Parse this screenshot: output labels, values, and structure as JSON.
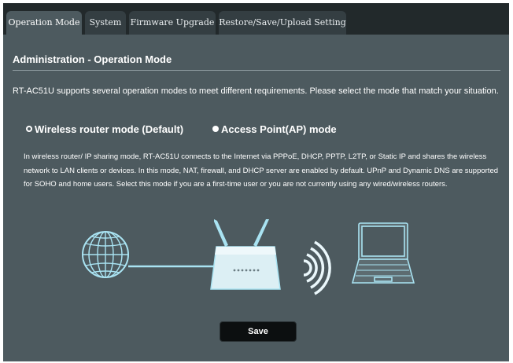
{
  "tabs": [
    {
      "label": "Operation Mode",
      "active": true
    },
    {
      "label": "System",
      "active": false
    },
    {
      "label": "Firmware Upgrade",
      "active": false
    },
    {
      "label": "Restore/Save/Upload Setting",
      "active": false
    }
  ],
  "page": {
    "title": "Administration - Operation Mode",
    "description": "RT-AC51U supports several operation modes to meet different requirements. Please select the mode that match your situation."
  },
  "modes": [
    {
      "label": "Wireless router mode (Default)",
      "selected": true
    },
    {
      "label": "Access Point(AP) mode",
      "selected": false
    }
  ],
  "mode_description": "In wireless router/ IP sharing mode, RT-AC51U connects to the Internet via PPPoE, DHCP, PPTP, L2TP, or Static IP and shares the wireless network to LAN clients or devices. In this mode, NAT, firewall, and DHCP server are enabled by default. UPnP and Dynamic DNS are supported for SOHO and home users. Select this mode if you are a first-time user or you are not currently using any wired/wireless routers.",
  "save_label": "Save",
  "colors": {
    "frame": "#22292b",
    "panel": "#4d5a5f",
    "tab": "#343e42",
    "illustration": "#a9e3f2"
  },
  "diagram_icons": [
    "globe-icon",
    "router-icon",
    "wireless-signal-icon",
    "laptop-icon"
  ]
}
